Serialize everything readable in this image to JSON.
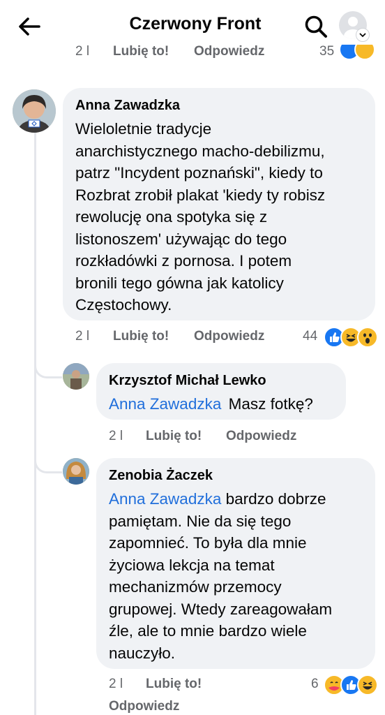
{
  "header": {
    "title": "Czerwony Front",
    "back_icon": "arrow-left-icon",
    "search_icon": "search-icon",
    "profile_icon": "profile-avatar-icon"
  },
  "prev_actions": {
    "time": "2 l",
    "like": "Lubię to!",
    "reply": "Odpowiedz",
    "reactions": "35"
  },
  "comments": [
    {
      "author": "Anna Zawadzka",
      "mention": "",
      "lines": [
        "Wieloletnie tradycje",
        "anarchistycznego macho-debilizmu,",
        "patrz \"Incydent poznański\", kiedy to",
        "Rozbrat zrobił plakat 'kiedy ty robisz",
        "rewolucję ona spotyka się z",
        "listonoszem' używając do tego",
        "rozkładówki z pornosa. I potem",
        "bronili tego gówna jak katolicy",
        "Częstochowy."
      ],
      "time": "2 l",
      "like": "Lubię to!",
      "reply": "Odpowiedz",
      "reactions": "44"
    },
    {
      "author": "Krzysztof Michał Lewko",
      "mention": "Anna Zawadzka",
      "text": "Masz fotkę?",
      "time": "2 l",
      "like": "Lubię to!",
      "reply": "Odpowiedz"
    },
    {
      "author": "Zenobia Żaczek",
      "mention": "Anna Zawadzka",
      "lines": [
        " bardzo dobrze",
        "pamiętam. Nie da się tego",
        "zapomnieć. To była dla mnie",
        "życiowa lekcja na temat",
        "mechanizmów przemocy",
        "grupowej. Wtedy zareagowałam",
        "źle, ale to mnie bardzo wiele",
        "nauczyło."
      ],
      "time": "2 l",
      "like": "Lubię to!",
      "reply": "Odpowiedz",
      "reactions": "6"
    }
  ],
  "colors": {
    "link": "#216fdb",
    "like_blue": "#1877f2",
    "haha_yellow": "#f7b928",
    "bubble_bg": "#f0f2f5",
    "meta_gray": "#65676b"
  }
}
